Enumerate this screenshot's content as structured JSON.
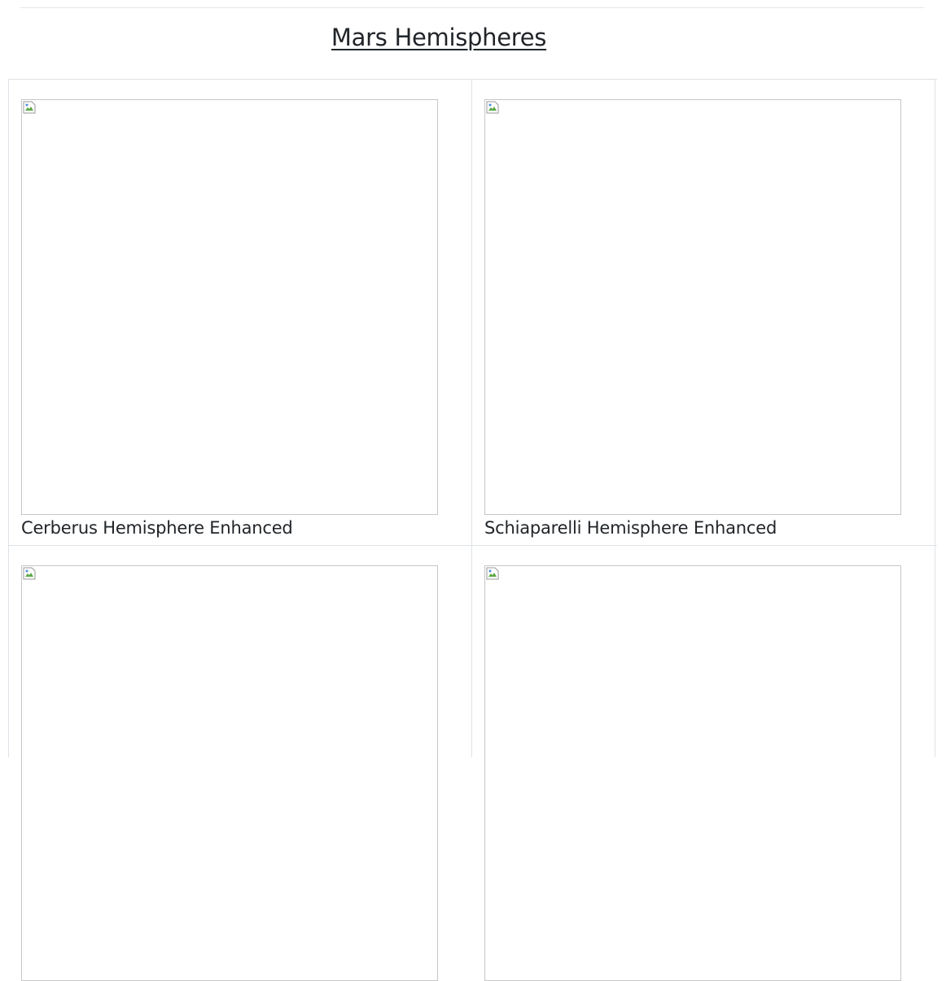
{
  "page": {
    "title": "Mars Hemispheres"
  },
  "hemispheres": [
    {
      "title": "Cerberus Hemisphere Enhanced"
    },
    {
      "title": "Schiaparelli Hemisphere Enhanced"
    },
    {
      "title": ""
    },
    {
      "title": ""
    }
  ],
  "icons": {
    "thumbnail": "broken-image-icon"
  },
  "colors": {
    "text": "#212529",
    "border": "#dee2e6"
  }
}
